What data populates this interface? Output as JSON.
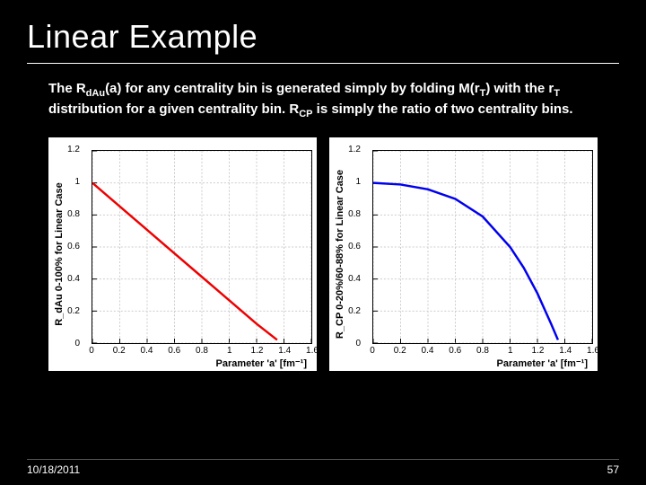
{
  "title": "Linear Example",
  "body_parts": {
    "p1": "The R",
    "sub1": "dAu",
    "p2": "(a) for any centrality bin is generated simply by folding M(r",
    "sub2": "T",
    "p3": ") with the r",
    "sub3": "T",
    "p4": " distribution for a given centrality bin.  R",
    "sub4": "CP",
    "p5": " is simply the ratio of two centrality bins."
  },
  "footer": {
    "date": "10/18/2011",
    "page": "57"
  },
  "chart_data": [
    {
      "type": "line",
      "title": "",
      "xlabel": "Parameter 'a' [fm⁻¹]",
      "ylabel": "R_dAu 0-100% for Linear Case",
      "xlim": [
        0,
        1.6
      ],
      "ylim": [
        0,
        1.2
      ],
      "xticks": [
        0,
        0.2,
        0.4,
        0.6,
        0.8,
        1.0,
        1.2,
        1.4,
        1.6
      ],
      "yticks": [
        0,
        0.2,
        0.4,
        0.6,
        0.8,
        1.0,
        1.2
      ],
      "series": [
        {
          "name": "RdAu",
          "color": "#e00",
          "x": [
            0.0,
            0.15,
            0.3,
            0.45,
            0.6,
            0.75,
            0.9,
            1.05,
            1.2,
            1.35
          ],
          "y": [
            1.0,
            0.89,
            0.78,
            0.67,
            0.56,
            0.45,
            0.34,
            0.23,
            0.12,
            0.02
          ]
        }
      ]
    },
    {
      "type": "line",
      "title": "",
      "xlabel": "Parameter 'a' [fm⁻¹]",
      "ylabel": "R_CP 0-20%/60-88% for Linear Case",
      "xlim": [
        0,
        1.6
      ],
      "ylim": [
        0,
        1.2
      ],
      "xticks": [
        0,
        0.2,
        0.4,
        0.6,
        0.8,
        1.0,
        1.2,
        1.4,
        1.6
      ],
      "yticks": [
        0,
        0.2,
        0.4,
        0.6,
        0.8,
        1.0,
        1.2
      ],
      "series": [
        {
          "name": "RCP",
          "color": "#00e",
          "x": [
            0.0,
            0.2,
            0.4,
            0.6,
            0.8,
            1.0,
            1.1,
            1.2,
            1.3,
            1.35
          ],
          "y": [
            1.0,
            0.99,
            0.96,
            0.9,
            0.79,
            0.6,
            0.47,
            0.31,
            0.12,
            0.02
          ]
        }
      ]
    }
  ]
}
